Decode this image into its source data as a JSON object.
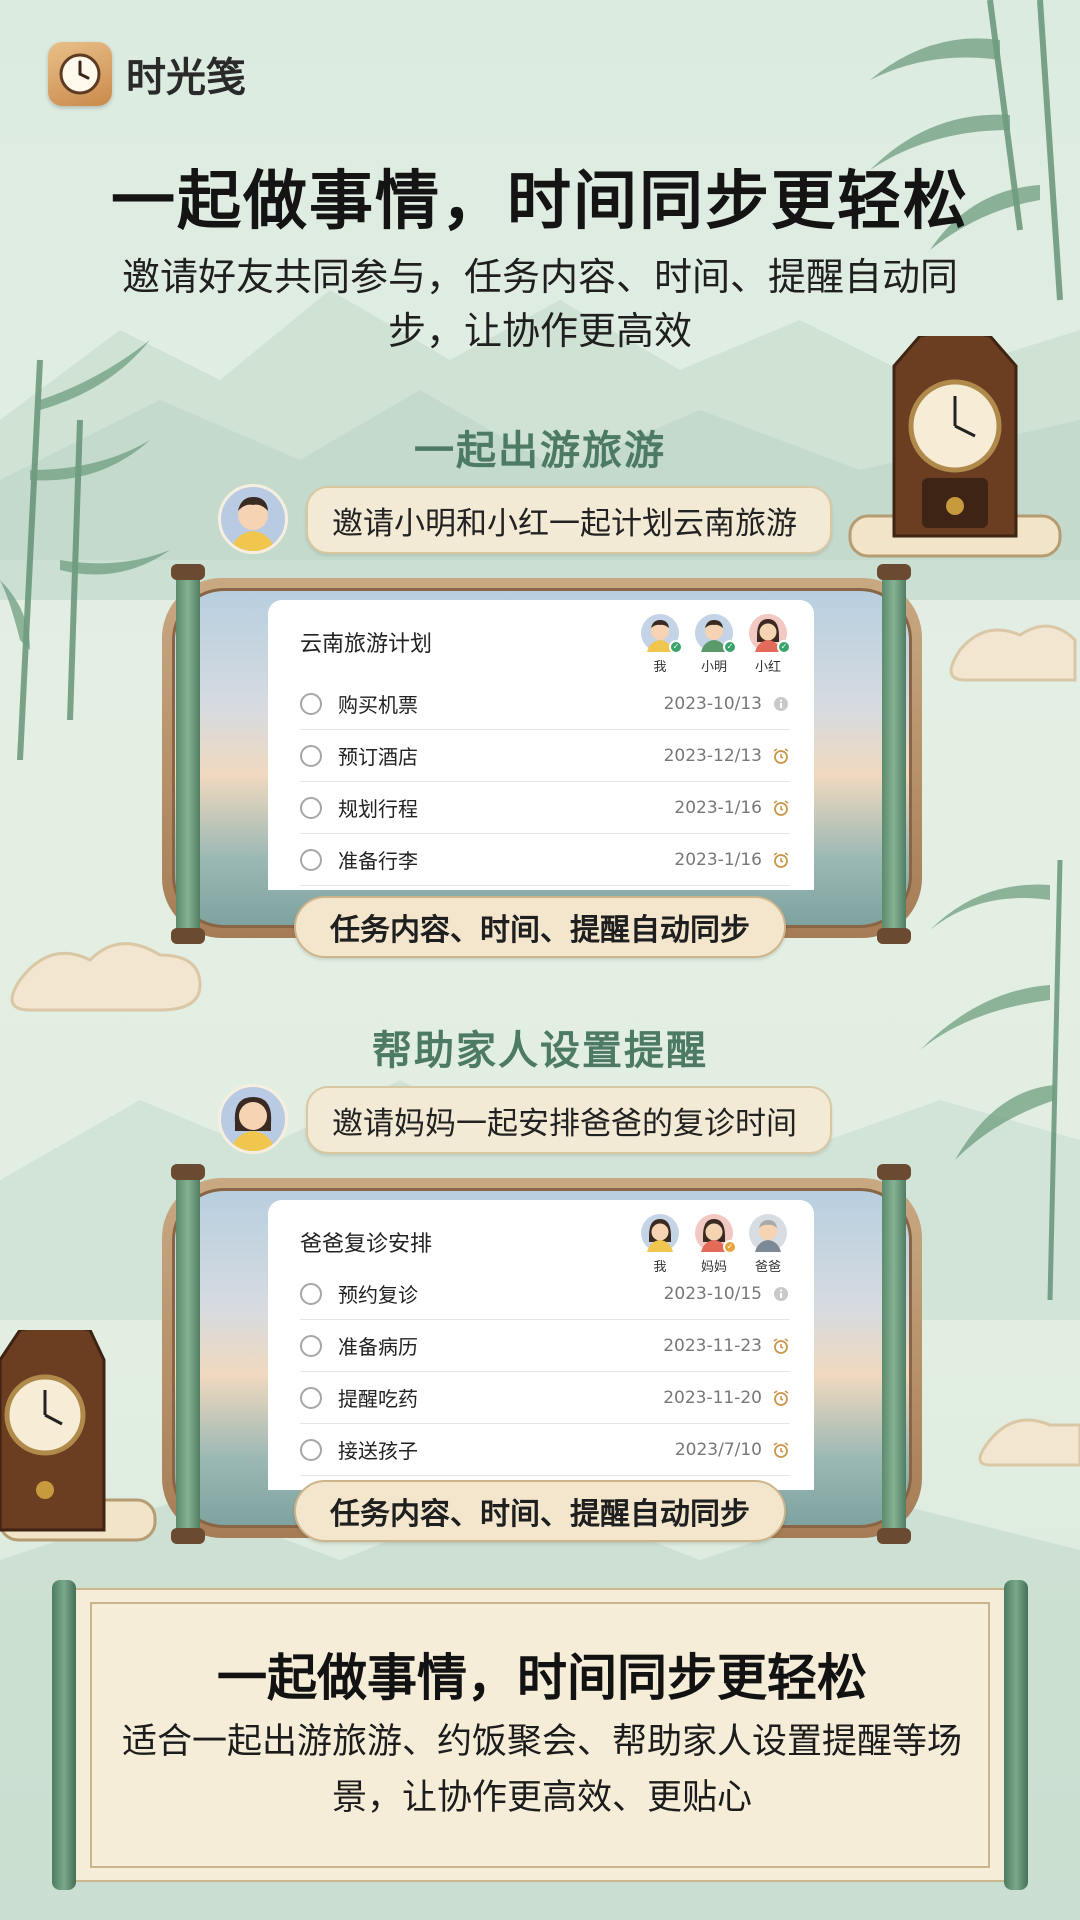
{
  "app": {
    "name": "时光笺"
  },
  "headline": "一起做事情，时间同步更轻松",
  "subline": "邀请好友共同参与，任务内容、时间、提醒自动同步，让协作更高效",
  "sections": [
    {
      "title": "一起出游旅游",
      "bubble": "邀请小明和小红一起计划云南旅游",
      "card_title": "云南旅游计划",
      "members": [
        {
          "name": "我"
        },
        {
          "name": "小明"
        },
        {
          "name": "小红"
        }
      ],
      "tasks": [
        {
          "name": "购买机票",
          "date": "2023-10/13",
          "icon": "info-icon"
        },
        {
          "name": "预订酒店",
          "date": "2023-12/13",
          "icon": "alarm-clock-icon"
        },
        {
          "name": "规划行程",
          "date": "2023-1/16",
          "icon": "alarm-clock-icon"
        },
        {
          "name": "准备行李",
          "date": "2023-1/16",
          "icon": "alarm-clock-icon"
        }
      ],
      "sync_label": "任务内容、时间、提醒自动同步"
    },
    {
      "title": "帮助家人设置提醒",
      "bubble": "邀请妈妈一起安排爸爸的复诊时间",
      "card_title": "爸爸复诊安排",
      "members": [
        {
          "name": "我"
        },
        {
          "name": "妈妈"
        },
        {
          "name": "爸爸"
        }
      ],
      "tasks": [
        {
          "name": "预约复诊",
          "date": "2023-10/15",
          "icon": "info-icon"
        },
        {
          "name": "准备病历",
          "date": "2023-11-23",
          "icon": "alarm-clock-icon"
        },
        {
          "name": "提醒吃药",
          "date": "2023-11-20",
          "icon": "alarm-clock-icon"
        },
        {
          "name": "接送孩子",
          "date": "2023/7/10",
          "icon": "alarm-clock-icon"
        }
      ],
      "sync_label": "任务内容、时间、提醒自动同步"
    }
  ],
  "bottom": {
    "title": "一起做事情，时间同步更轻松",
    "text": "适合一起出游旅游、约饭聚会、帮助家人设置提醒等场景，让协作更高效、更贴心"
  },
  "colors": {
    "section_title": "#4d7a62",
    "check": "#3aa36a",
    "bamboo": "#5b8a6e"
  }
}
